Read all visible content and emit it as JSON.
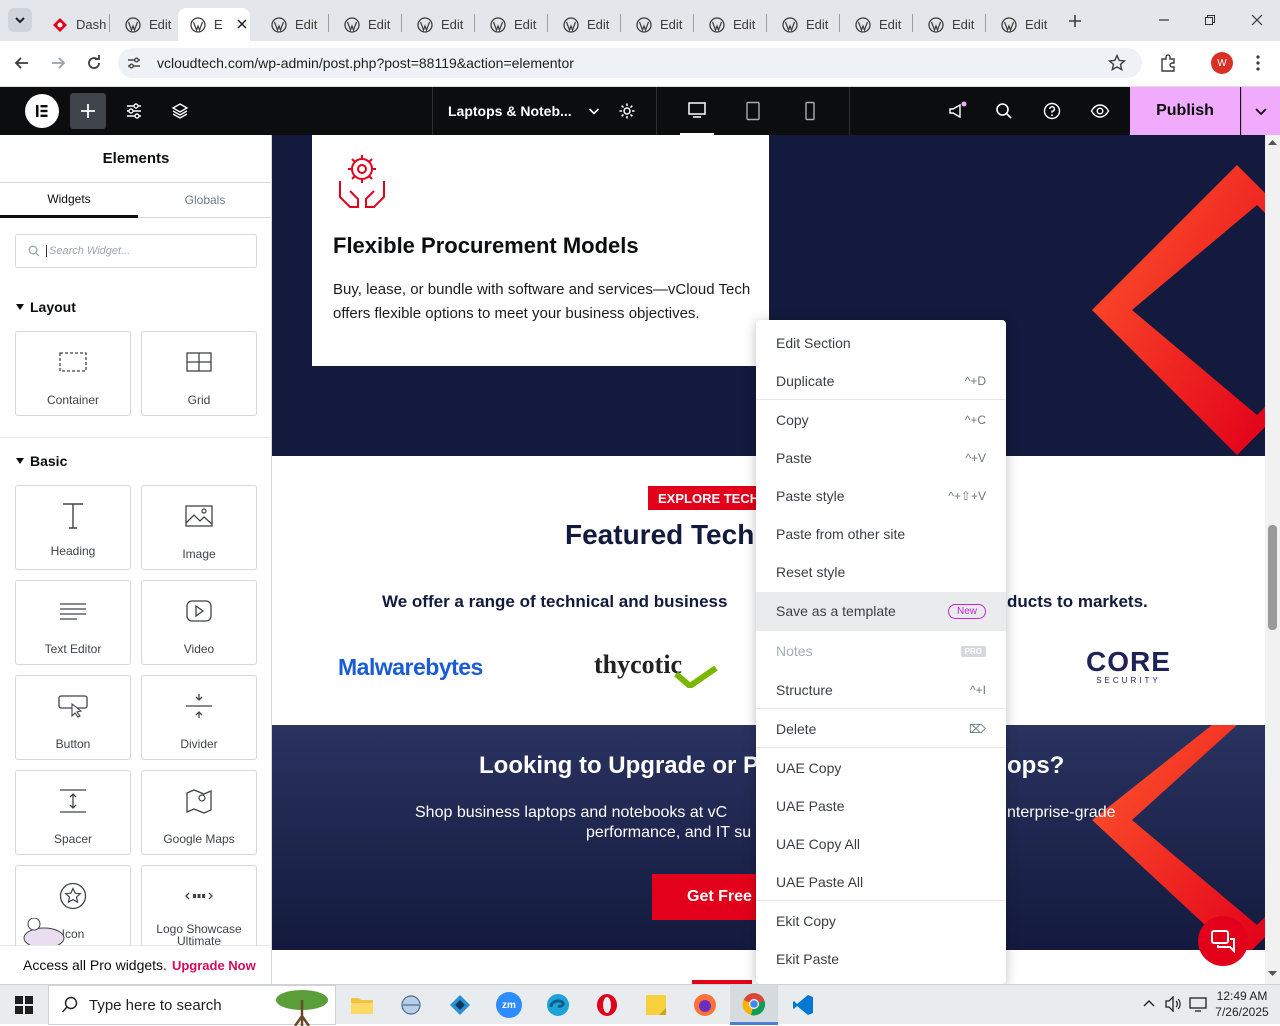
{
  "browser": {
    "tabs": [
      {
        "label": "Dash",
        "active": false
      },
      {
        "label": "Edit",
        "active": false
      },
      {
        "label": "E",
        "active": true
      },
      {
        "label": "Edit",
        "active": false
      },
      {
        "label": "Edit",
        "active": false
      },
      {
        "label": "Edit",
        "active": false
      },
      {
        "label": "Edit",
        "active": false
      },
      {
        "label": "Edit",
        "active": false
      },
      {
        "label": "Edit",
        "active": false
      },
      {
        "label": "Edit",
        "active": false
      },
      {
        "label": "Edit",
        "active": false
      },
      {
        "label": "Edit",
        "active": false
      },
      {
        "label": "Edit",
        "active": false
      },
      {
        "label": "Edit",
        "active": false
      }
    ],
    "url": "vcloudtech.com/wp-admin/post.php?post=88119&action=elementor",
    "profile_initial": "W"
  },
  "editor": {
    "page_selector": "Laptops & Noteb...",
    "publish_label": "Publish"
  },
  "panel": {
    "title": "Elements",
    "tabs": [
      "Widgets",
      "Globals"
    ],
    "search_placeholder": "Search Widget...",
    "sections": {
      "layout": "Layout",
      "basic": "Basic"
    },
    "layout_widgets": [
      "Container",
      "Grid"
    ],
    "basic_widgets": [
      "Heading",
      "Image",
      "Text Editor",
      "Video",
      "Button",
      "Divider",
      "Spacer",
      "Google Maps",
      "Icon",
      "Logo Showcase Ultimate"
    ],
    "promo_text": "Access all Pro widgets.",
    "promo_link": "Upgrade Now"
  },
  "canvas": {
    "card_title": "Flexible Procurement Models",
    "card_text": "Buy, lease, or bundle with software and services—vCloud Tech offers flexible options to meet your business objectives.",
    "badge": "EXPLORE TECH",
    "featured_heading": "Featured Tech",
    "featured_sub_left": "We offer a range of technical and business",
    "featured_sub_right": "ducts to markets.",
    "logos": [
      "Malwarebytes",
      "thycotic",
      "CORE",
      "SECURITY"
    ],
    "cta_heading_left": "Looking to Upgrade or P",
    "cta_heading_right": "ops?",
    "cta_text_left_1": "Shop business laptops and notebooks at vC",
    "cta_text_left_2": "performance, and IT su",
    "cta_text_right": "nterprise-grade",
    "cta_button": "Get Free"
  },
  "context_menu": {
    "items": [
      {
        "label": "Edit Section",
        "shortcut": ""
      },
      {
        "label": "Duplicate",
        "shortcut": "^+D"
      },
      {
        "label": "Copy",
        "shortcut": "^+C"
      },
      {
        "label": "Paste",
        "shortcut": "^+V"
      },
      {
        "label": "Paste style",
        "shortcut": "^+⇧+V"
      },
      {
        "label": "Paste from other site",
        "shortcut": ""
      },
      {
        "label": "Reset style",
        "shortcut": ""
      },
      {
        "label": "Save as a template",
        "shortcut": "New"
      },
      {
        "label": "Notes",
        "shortcut": "PRO"
      },
      {
        "label": "Structure",
        "shortcut": "^+I"
      },
      {
        "label": "Delete",
        "shortcut": "⌦"
      },
      {
        "label": "UAE Copy",
        "shortcut": ""
      },
      {
        "label": "UAE Paste",
        "shortcut": ""
      },
      {
        "label": "UAE Copy All",
        "shortcut": ""
      },
      {
        "label": "UAE Paste All",
        "shortcut": ""
      },
      {
        "label": "Ekit Copy",
        "shortcut": ""
      },
      {
        "label": "Ekit Paste",
        "shortcut": ""
      }
    ]
  },
  "taskbar": {
    "search_placeholder": "Type here to search",
    "time": "12:49 AM",
    "date": "7/26/2025"
  },
  "colors": {
    "accent_red": "#e2001a",
    "navy": "#131a3d",
    "elementor_pink": "#f0abfc",
    "menu_new": "#c026d3"
  }
}
